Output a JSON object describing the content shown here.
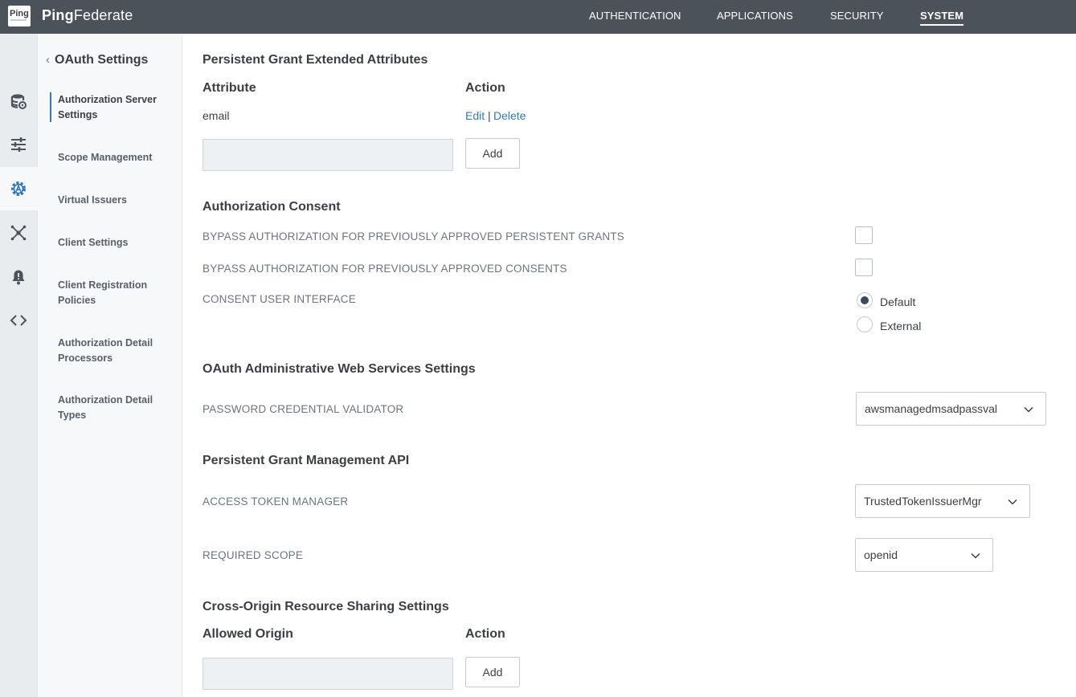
{
  "app": {
    "logo_text": "Ping",
    "brand_bold": "Ping",
    "brand_rest": "Federate"
  },
  "topnav": [
    {
      "label": "AUTHENTICATION",
      "active": false
    },
    {
      "label": "APPLICATIONS",
      "active": false
    },
    {
      "label": "SECURITY",
      "active": false
    },
    {
      "label": "SYSTEM",
      "active": true
    }
  ],
  "rail": [
    {
      "icon": "database-icon"
    },
    {
      "icon": "sliders-icon"
    },
    {
      "icon": "oauth-gear-icon",
      "active": true
    },
    {
      "icon": "network-icon"
    },
    {
      "icon": "bell-icon"
    },
    {
      "icon": "code-icon"
    }
  ],
  "subnav": {
    "back_label": "OAuth Settings",
    "items": [
      {
        "label": "Authorization Server Settings",
        "active": true
      },
      {
        "label": "Scope Management"
      },
      {
        "label": "Virtual Issuers"
      },
      {
        "label": "Client Settings"
      },
      {
        "label": "Client Registration Policies"
      },
      {
        "label": "Authorization Detail Processors"
      },
      {
        "label": "Authorization Detail Types"
      }
    ]
  },
  "persistent_grant": {
    "title": "Persistent Grant Extended Attributes",
    "col_attribute": "Attribute",
    "col_action": "Action",
    "rows": [
      {
        "attribute": "email",
        "edit": "Edit",
        "separator": "|",
        "delete": "Delete"
      }
    ],
    "input_value": "",
    "add_label": "Add"
  },
  "authorization_consent": {
    "title": "Authorization Consent",
    "bypass_grants_label": "BYPASS AUTHORIZATION FOR PREVIOUSLY APPROVED PERSISTENT GRANTS",
    "bypass_grants_checked": false,
    "bypass_consents_label": "BYPASS AUTHORIZATION FOR PREVIOUSLY APPROVED CONSENTS",
    "bypass_consents_checked": false,
    "consent_ui_label": "CONSENT USER INTERFACE",
    "consent_ui_options": [
      "Default",
      "External"
    ],
    "consent_ui_selected": "Default"
  },
  "admin_ws": {
    "title": "OAuth Administrative Web Services Settings",
    "pcv_label": "PASSWORD CREDENTIAL VALIDATOR",
    "pcv_value": "awsmanagedmsadpassval"
  },
  "grant_api": {
    "title": "Persistent Grant Management API",
    "atm_label": "ACCESS TOKEN MANAGER",
    "atm_value": "TrustedTokenIssuerMgr",
    "scope_label": "REQUIRED SCOPE",
    "scope_value": "openid"
  },
  "cors": {
    "title": "Cross-Origin Resource Sharing Settings",
    "col_origin": "Allowed Origin",
    "col_action": "Action",
    "input_value": "",
    "add_label": "Add"
  },
  "colors": {
    "topbar": "#4b525a",
    "accent": "#2f76bd",
    "link": "#2f7ab8"
  }
}
